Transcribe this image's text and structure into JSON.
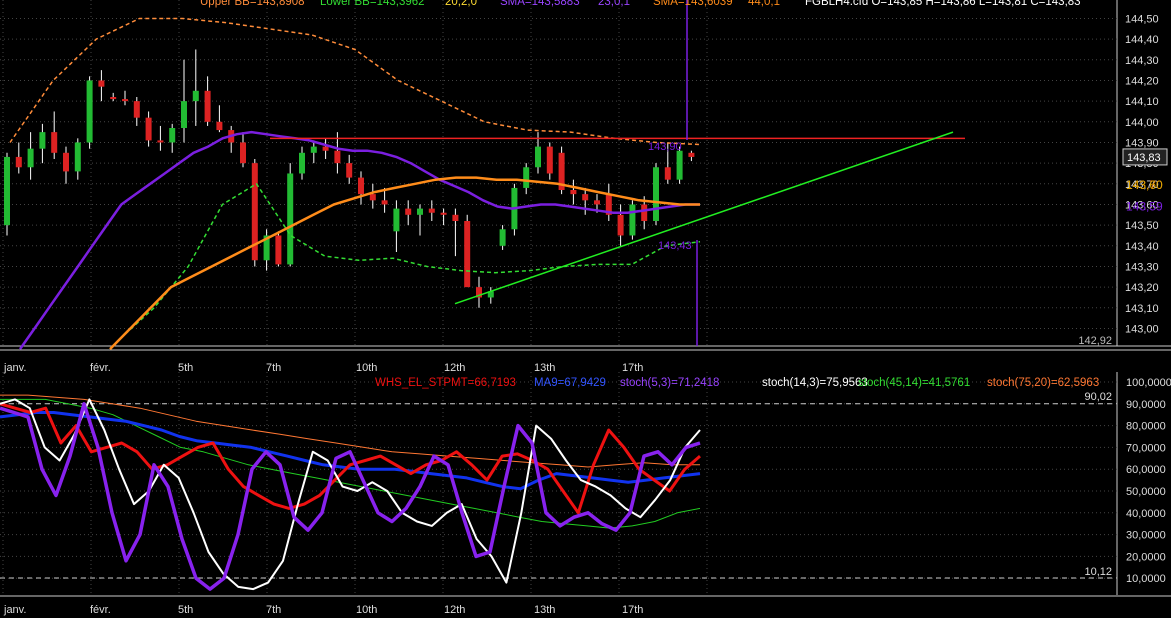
{
  "header": {
    "upper_bb": "Upper BB=143,8908",
    "lower_bb": "Lower BB=143,3962",
    "bb_params": "20,2,0",
    "sma1": "SMA=143,5883",
    "sma1_params": "23,0,1",
    "sma2": "SMA=143,6039",
    "sma2_params": "44,0,1",
    "symbol_ohlc": "FGBLH4.cfd O=143,85 H=143,86 L=143,81 C=143,83"
  },
  "lower_header": {
    "whs": "WHS_EL_STPMT=66,7193",
    "ma": "MA9=67,9429",
    "stoch5": "stoch(5,3)=71,2418",
    "stoch14": "stoch(14,3)=75,9563",
    "stoch45": "stoch(45,14)=41,5761",
    "stoch75": "stoch(75,20)=62,5963"
  },
  "x_labels": [
    "janv.",
    "févr.",
    "5th",
    "7th",
    "10th",
    "12th",
    "13th",
    "17th"
  ],
  "price_labels": {
    "last": "143,83",
    "sma2_value": "143,70",
    "sma1_value": "143,60",
    "sma1_alt": "143,59",
    "high_mark": "143,90",
    "low_mark": "143,43",
    "bottom_value": "142,92"
  },
  "osc_levels": {
    "upper": "90,02",
    "lower": "10,12"
  },
  "colors": {
    "bull": "#22bb33",
    "bear": "#dd2222",
    "sma23": "#7b1fe0",
    "sma44": "#ff8c1a",
    "bb": "#ff8c3a",
    "bb_lower": "#33dd33",
    "resistance": "#ee2222",
    "support": "#22ee22",
    "stpmt": "#ee1111",
    "ma9": "#1133ee",
    "stoch5": "#8822ee",
    "stoch14": "#ffffff",
    "stoch45": "#22cc22",
    "stoch75": "#ff7733"
  },
  "chart_data": [
    {
      "type": "candlestick",
      "title": "FGBLH4.cfd",
      "ylim": [
        142.92,
        144.57
      ],
      "y_ticks": [
        "144,50",
        "144,40",
        "144,30",
        "144,20",
        "144,10",
        "144,00",
        "143,90",
        "143,80",
        "143,70",
        "143,60",
        "143,50",
        "143,40",
        "143,30",
        "143,20",
        "143,10",
        "143,00"
      ],
      "candles": [
        [
          143.5,
          143.85,
          143.45,
          143.83
        ],
        [
          143.83,
          143.9,
          143.75,
          143.78
        ],
        [
          143.78,
          143.95,
          143.72,
          143.87
        ],
        [
          143.87,
          143.99,
          143.8,
          143.95
        ],
        [
          143.95,
          144.05,
          143.82,
          143.85
        ],
        [
          143.85,
          143.88,
          143.7,
          143.76
        ],
        [
          143.76,
          143.92,
          143.72,
          143.9
        ],
        [
          143.9,
          144.22,
          143.87,
          144.2
        ],
        [
          144.2,
          144.25,
          144.1,
          144.17
        ],
        [
          144.12,
          144.14,
          144.1,
          144.11
        ],
        [
          144.11,
          144.15,
          144.08,
          144.1
        ],
        [
          144.1,
          144.12,
          143.98,
          144.02
        ],
        [
          144.02,
          144.05,
          143.88,
          143.91
        ],
        [
          143.91,
          143.98,
          143.86,
          143.9
        ],
        [
          143.9,
          143.99,
          143.85,
          143.97
        ],
        [
          143.97,
          144.3,
          143.9,
          144.1
        ],
        [
          144.1,
          144.35,
          143.98,
          144.15
        ],
        [
          144.15,
          144.22,
          143.98,
          144.0
        ],
        [
          144.0,
          144.08,
          143.95,
          143.96
        ],
        [
          143.96,
          143.98,
          143.85,
          143.9
        ],
        [
          143.9,
          143.95,
          143.78,
          143.8
        ],
        [
          143.8,
          143.82,
          143.3,
          143.33
        ],
        [
          143.33,
          143.48,
          143.28,
          143.45
        ],
        [
          143.45,
          143.47,
          143.3,
          143.31
        ],
        [
          143.31,
          143.8,
          143.3,
          143.75
        ],
        [
          143.75,
          143.88,
          143.72,
          143.85
        ],
        [
          143.85,
          143.91,
          143.8,
          143.88
        ],
        [
          143.88,
          143.92,
          143.82,
          143.86
        ],
        [
          143.86,
          143.95,
          143.75,
          143.8
        ],
        [
          143.8,
          143.84,
          143.7,
          143.73
        ],
        [
          143.73,
          143.76,
          143.6,
          143.65
        ],
        [
          143.65,
          143.7,
          143.58,
          143.62
        ],
        [
          143.62,
          143.68,
          143.56,
          143.6
        ],
        [
          143.47,
          143.62,
          143.37,
          143.58
        ],
        [
          143.58,
          143.62,
          143.5,
          143.55
        ],
        [
          143.55,
          143.6,
          143.45,
          143.58
        ],
        [
          143.58,
          143.62,
          143.52,
          143.56
        ],
        [
          143.56,
          143.58,
          143.5,
          143.55
        ],
        [
          143.55,
          143.58,
          143.35,
          143.52
        ],
        [
          143.52,
          143.55,
          143.3,
          143.2
        ],
        [
          143.2,
          143.25,
          143.1,
          143.15
        ],
        [
          143.15,
          143.2,
          143.12,
          143.18
        ],
        [
          143.4,
          143.5,
          143.38,
          143.48
        ],
        [
          143.48,
          143.7,
          143.45,
          143.68
        ],
        [
          143.68,
          143.8,
          143.65,
          143.78
        ],
        [
          143.78,
          143.95,
          143.75,
          143.88
        ],
        [
          143.88,
          143.9,
          143.72,
          143.75
        ],
        [
          143.85,
          143.88,
          143.65,
          143.67
        ],
        [
          143.67,
          143.72,
          143.6,
          143.65
        ],
        [
          143.65,
          143.68,
          143.55,
          143.62
        ],
        [
          143.62,
          143.65,
          143.56,
          143.6
        ],
        [
          143.65,
          143.7,
          143.52,
          143.55
        ],
        [
          143.55,
          143.6,
          143.4,
          143.45
        ],
        [
          143.45,
          143.62,
          143.43,
          143.6
        ],
        [
          143.6,
          143.64,
          143.48,
          143.52
        ],
        [
          143.52,
          143.8,
          143.5,
          143.78
        ],
        [
          143.78,
          143.9,
          143.7,
          143.72
        ],
        [
          143.72,
          143.88,
          143.7,
          143.86
        ],
        [
          143.85,
          143.86,
          143.81,
          143.83
        ]
      ],
      "sma23": [
        142.9,
        143.0,
        143.1,
        143.2,
        143.3,
        143.4,
        143.5,
        143.6,
        143.65,
        143.7,
        143.75,
        143.8,
        143.85,
        143.88,
        143.92,
        143.94,
        143.95,
        143.94,
        143.93,
        143.92,
        143.91,
        143.89,
        143.87,
        143.86,
        143.86,
        143.85,
        143.83,
        143.8,
        143.76,
        143.72,
        143.69,
        143.66,
        143.62,
        143.59,
        143.58,
        143.59,
        143.6,
        143.6,
        143.59,
        143.58,
        143.57,
        143.56,
        143.56,
        143.57,
        143.58,
        143.59,
        143.6,
        143.6
      ],
      "sma44": [
        142.9,
        143.0,
        143.1,
        143.2,
        143.25,
        143.3,
        143.35,
        143.4,
        143.45,
        143.5,
        143.55,
        143.6,
        143.63,
        143.66,
        143.68,
        143.7,
        143.72,
        143.73,
        143.73,
        143.72,
        143.72,
        143.71,
        143.7,
        143.68,
        143.66,
        143.64,
        143.62,
        143.61,
        143.6,
        143.6
      ],
      "bb_upper": [
        143.9,
        144.2,
        144.4,
        144.5,
        144.5,
        144.48,
        144.45,
        144.42,
        144.35,
        144.2,
        144.1,
        144.0,
        143.96,
        143.95,
        143.92,
        143.9,
        143.89
      ],
      "bb_lower": [
        142.95,
        143.1,
        143.3,
        143.6,
        143.7,
        143.45,
        143.35,
        143.33,
        143.34,
        143.3,
        143.28,
        143.27,
        143.28,
        143.3,
        143.31,
        143.31,
        143.4,
        143.42
      ],
      "resistance": 143.92,
      "support": [
        [
          143.12,
          143.95
        ]
      ]
    },
    {
      "type": "line",
      "title": "WHS_EL_STPMT",
      "ylim": [
        0,
        100
      ],
      "y_ticks": [
        "100,0000",
        "90,0000",
        "80,0000",
        "70,0000",
        "60,0000",
        "50,0000",
        "40,0000",
        "30,0000",
        "20,0000",
        "10,0000"
      ],
      "series": [
        {
          "name": "WHS_EL_STPMT",
          "values": [
            90,
            88,
            86,
            88,
            72,
            80,
            68,
            70,
            72,
            68,
            60,
            62,
            66,
            70,
            72,
            60,
            52,
            48,
            44,
            42,
            44,
            48,
            55,
            62,
            64,
            66,
            62,
            58,
            62,
            64,
            68,
            62,
            55,
            66,
            67,
            64,
            60,
            50,
            40,
            62,
            78,
            70,
            60,
            55,
            50,
            60,
            66
          ]
        },
        {
          "name": "MA9",
          "values": [
            84,
            85,
            86,
            86,
            85,
            84,
            83,
            82,
            80,
            78,
            75,
            73,
            72,
            71,
            70,
            68,
            66,
            64,
            62,
            61,
            60,
            60,
            60,
            59,
            58,
            57,
            56,
            54,
            52,
            51,
            55,
            58,
            57,
            56,
            55,
            54,
            55,
            56,
            57,
            58
          ]
        },
        {
          "name": "stoch(5,3)",
          "values": [
            88,
            86,
            84,
            60,
            48,
            66,
            90,
            70,
            40,
            18,
            30,
            62,
            52,
            28,
            10,
            5,
            10,
            30,
            60,
            68,
            62,
            38,
            32,
            40,
            65,
            68,
            54,
            40,
            36,
            42,
            52,
            66,
            62,
            40,
            20,
            22,
            52,
            80,
            72,
            40,
            34,
            38,
            40,
            35,
            32,
            40,
            66,
            68,
            62,
            70,
            72
          ]
        },
        {
          "name": "stoch(14,3)",
          "values": [
            90,
            92,
            88,
            70,
            64,
            76,
            92,
            78,
            60,
            44,
            50,
            62,
            56,
            40,
            22,
            12,
            6,
            5,
            8,
            18,
            44,
            68,
            64,
            52,
            50,
            54,
            50,
            40,
            36,
            34,
            40,
            44,
            28,
            20,
            8,
            40,
            80,
            74,
            64,
            55,
            52,
            48,
            42,
            38,
            46,
            55,
            70,
            78
          ]
        },
        {
          "name": "stoch(45,14)",
          "values": [
            92,
            92,
            92,
            90,
            88,
            85,
            80,
            75,
            70,
            68,
            65,
            62,
            60,
            58,
            56,
            54,
            52,
            50,
            48,
            46,
            44,
            42,
            40,
            38,
            36,
            35,
            34,
            33,
            34,
            36,
            40,
            42
          ]
        },
        {
          "name": "stoch(75,20)",
          "values": [
            94,
            94,
            93,
            92,
            90,
            88,
            85,
            82,
            80,
            78,
            76,
            74,
            72,
            70,
            68,
            67,
            66,
            65,
            64,
            63,
            62,
            61,
            62,
            63,
            62,
            62
          ]
        }
      ],
      "levels": [
        90.02,
        10.12
      ]
    }
  ]
}
